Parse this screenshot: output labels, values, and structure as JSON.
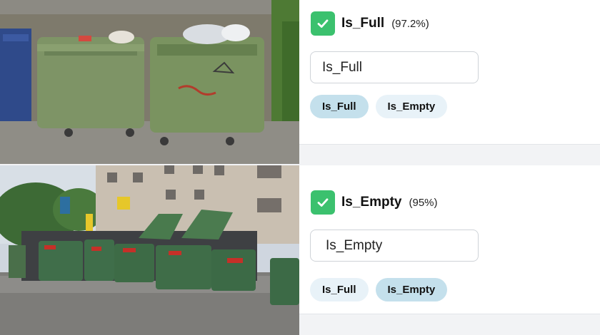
{
  "rows": [
    {
      "prediction": {
        "label": "Is_Full",
        "confidence": "(97.2%)"
      },
      "label_value": "Is_Full",
      "chips": [
        {
          "label": "Is_Full",
          "selected": true
        },
        {
          "label": "Is_Empty",
          "selected": false
        }
      ]
    },
    {
      "prediction": {
        "label": "Is_Empty",
        "confidence": "(95%)"
      },
      "label_value": "Is_Empty",
      "chips": [
        {
          "label": "Is_Full",
          "selected": false
        },
        {
          "label": "Is_Empty",
          "selected": true
        }
      ]
    }
  ],
  "colors": {
    "check_green": "#3bc16e",
    "chip_selected": "#c4e0ec",
    "chip_default": "#e8f2f8"
  },
  "icons": {
    "prediction_status": "check-icon"
  }
}
